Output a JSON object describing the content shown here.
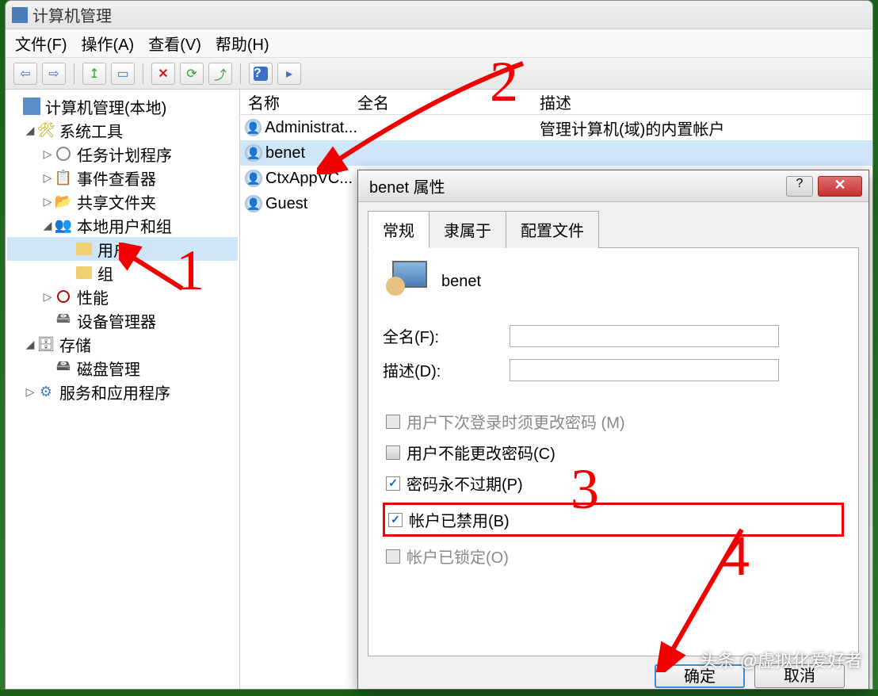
{
  "window": {
    "title": "计算机管理"
  },
  "menu": {
    "file": "文件(F)",
    "action": "操作(A)",
    "view": "查看(V)",
    "help": "帮助(H)"
  },
  "toolbar_icons": {
    "back": "back-icon",
    "forward": "forward-icon",
    "up": "up-icon",
    "show": "show-icon",
    "delete": "delete-icon",
    "refresh": "refresh-icon",
    "export": "export-icon",
    "help": "help-icon",
    "properties": "properties-icon"
  },
  "tree": {
    "root": "计算机管理(本地)",
    "systools": "系统工具",
    "task_sched": "任务计划程序",
    "event_viewer": "事件查看器",
    "shared": "共享文件夹",
    "local_users": "本地用户和组",
    "users": "用户",
    "groups": "组",
    "perf": "性能",
    "devmgr": "设备管理器",
    "storage": "存储",
    "diskmgmt": "磁盘管理",
    "services": "服务和应用程序"
  },
  "list": {
    "header": {
      "name": "名称",
      "fullname": "全名",
      "desc": "描述"
    },
    "rows": [
      {
        "name": "Administrat...",
        "full": "",
        "desc": "管理计算机(域)的内置帐户"
      },
      {
        "name": "benet",
        "full": "",
        "desc": ""
      },
      {
        "name": "CtxAppVC...",
        "full": "",
        "desc": ""
      },
      {
        "name": "Guest",
        "full": "",
        "desc": ""
      }
    ]
  },
  "dialog": {
    "title": "benet 属性",
    "tabs": {
      "general": "常规",
      "memberof": "隶属于",
      "profile": "配置文件"
    },
    "user_name": "benet",
    "fullname_label": "全名(F):",
    "desc_label": "描述(D):",
    "cb_must_change": "用户下次登录时须更改密码 (M)",
    "cb_cant_change": "用户不能更改密码(C)",
    "cb_never_expire": "密码永不过期(P)",
    "cb_disabled": "帐户已禁用(B)",
    "cb_locked": "帐户已锁定(O)",
    "ok": "确定",
    "cancel": "取消"
  },
  "annotations": {
    "n1": "1",
    "n2": "2",
    "n3": "3",
    "n4": "4"
  },
  "watermark": "头条 @虚拟化爱好者"
}
